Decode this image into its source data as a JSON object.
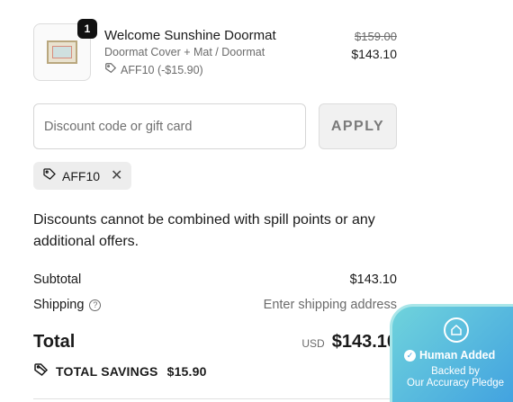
{
  "line_item": {
    "quantity": "1",
    "title": "Welcome Sunshine Doormat",
    "variant": "Doormat Cover + Mat / Doormat",
    "discount": "AFF10 (-$15.90)",
    "price_original": "$159.00",
    "price_final": "$143.10"
  },
  "discount_form": {
    "placeholder": "Discount code or gift card",
    "value": "",
    "apply_label": "APPLY"
  },
  "applied_code": {
    "code": "AFF10",
    "remove_glyph": "✕"
  },
  "notice": "Discounts cannot be combined with spill points or any additional offers.",
  "summary": {
    "subtotal_label": "Subtotal",
    "subtotal_value": "$143.10",
    "shipping_label": "Shipping",
    "shipping_value": "Enter shipping address",
    "total_label": "Total",
    "currency": "USD",
    "total_value": "$143.10",
    "savings_label": "TOTAL SAVINGS",
    "savings_value": "$15.90"
  },
  "badge": {
    "title": "Human Added",
    "line1": "Backed by",
    "line2": "Our Accuracy Pledge"
  },
  "icons": {
    "tag": "tag-icon",
    "help": "question-circle-icon",
    "remove": "close-icon",
    "badge": "home-shield-icon",
    "check": "check-circle-icon"
  },
  "colors": {
    "text": "#1a1a1a",
    "muted": "#6b6b6b",
    "badge_gradient_start": "#6fd3dc",
    "badge_gradient_end": "#3f9fe0"
  }
}
